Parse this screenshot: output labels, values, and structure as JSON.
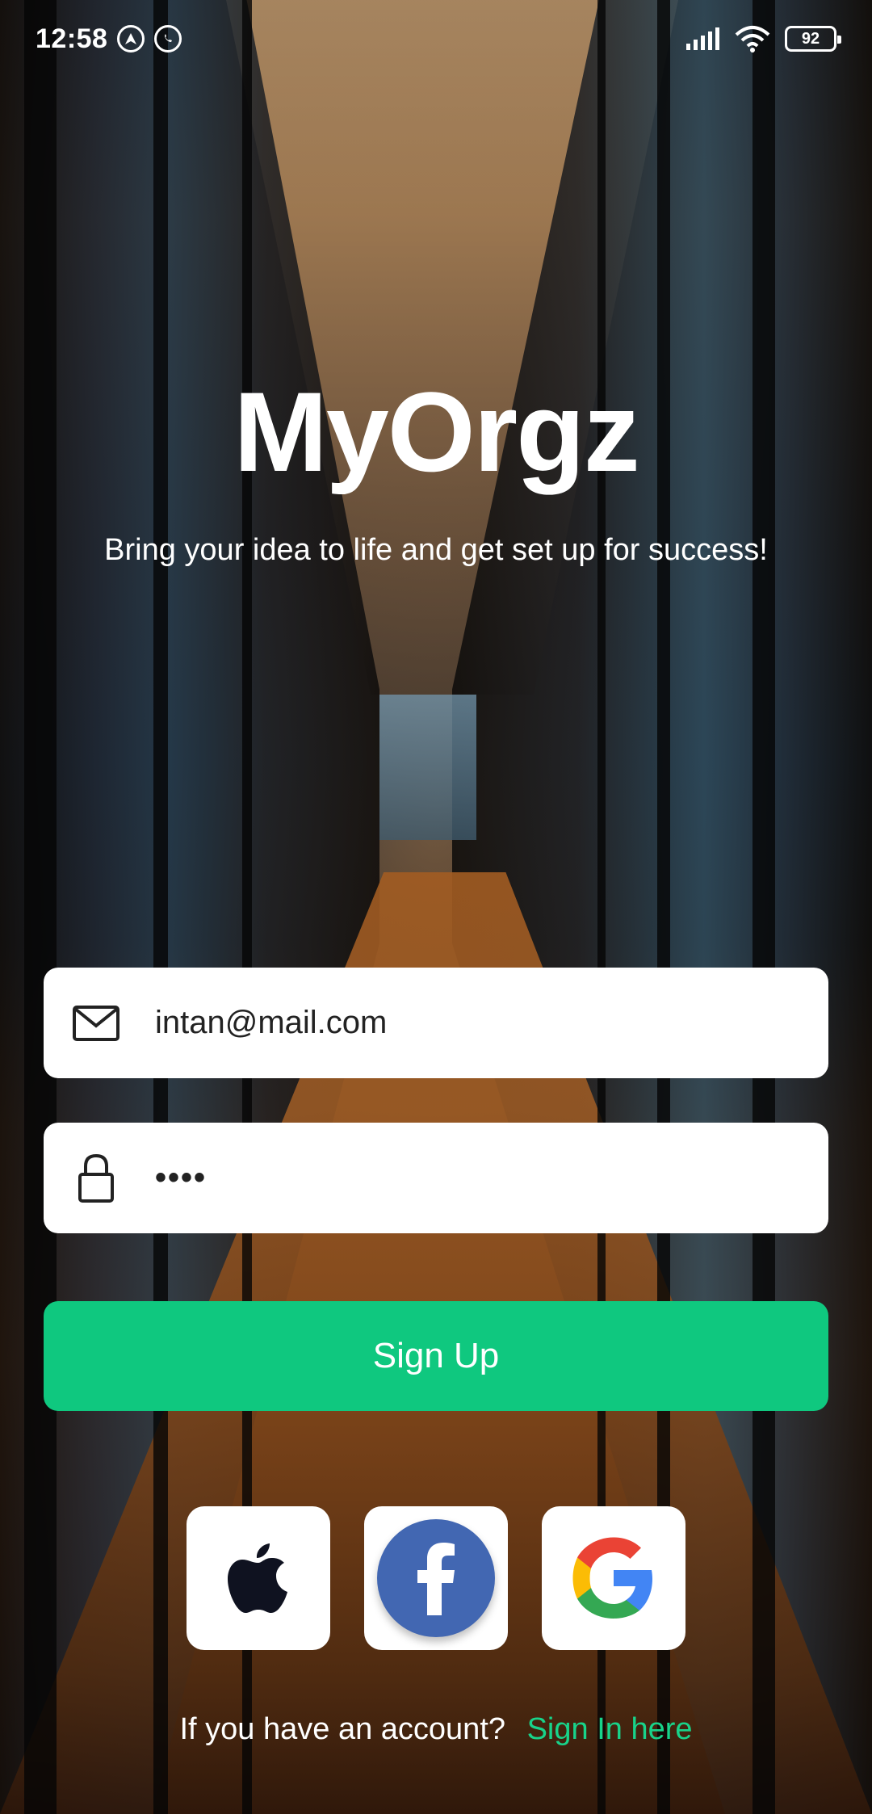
{
  "status_bar": {
    "time": "12:58",
    "battery": "92"
  },
  "hero": {
    "title": "MyOrgz",
    "subtitle": "Bring your idea to life and get set up for success!"
  },
  "form": {
    "email_value": "intan@mail.com",
    "password_value": "••••",
    "email_icon": "mail-icon",
    "password_icon": "lock-icon"
  },
  "signup_button": {
    "label": "Sign Up",
    "color": "#0fc87f"
  },
  "social": {
    "apple_icon": "apple-icon",
    "facebook_icon": "facebook-icon",
    "google_icon": "google-icon"
  },
  "footer": {
    "prompt": "If you have an account?",
    "link": "Sign In here",
    "link_color": "#18d38a"
  }
}
